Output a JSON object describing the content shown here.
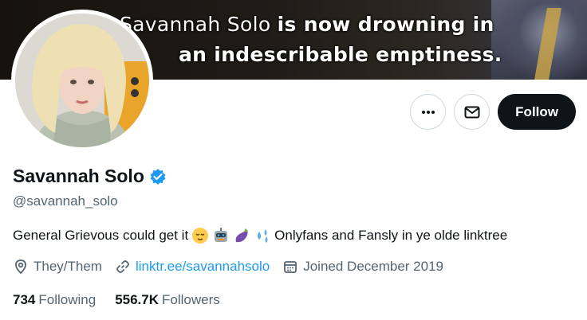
{
  "banner": {
    "line1_name": "Savannah Solo",
    "line1_rest": "is now drowning in",
    "line2": "an indescribable emptiness."
  },
  "actions": {
    "more_icon": "more-dots-icon",
    "message_icon": "envelope-icon",
    "follow_label": "Follow"
  },
  "profile": {
    "display_name": "Savannah Solo",
    "verified_icon": "verified-badge-icon",
    "handle": "@savannah_solo",
    "bio_text_1": "General Grievous could get it",
    "bio_emojis": [
      "relieved-face-emoji",
      "robot-emoji",
      "eggplant-emoji",
      "sweat-droplets-emoji"
    ],
    "bio_text_2": "Onlyfans and Fansly in ye olde linktree",
    "pronouns": "They/Them",
    "website": "linktr.ee/savannahsolo",
    "joined": "Joined December 2019",
    "following_count": "734",
    "following_label": "Following",
    "followers_count": "556.7K",
    "followers_label": "Followers"
  },
  "colors": {
    "accent": "#1d9bf0",
    "text_primary": "#0f1419",
    "text_secondary": "#536471",
    "follow_bg": "#0f1419"
  }
}
